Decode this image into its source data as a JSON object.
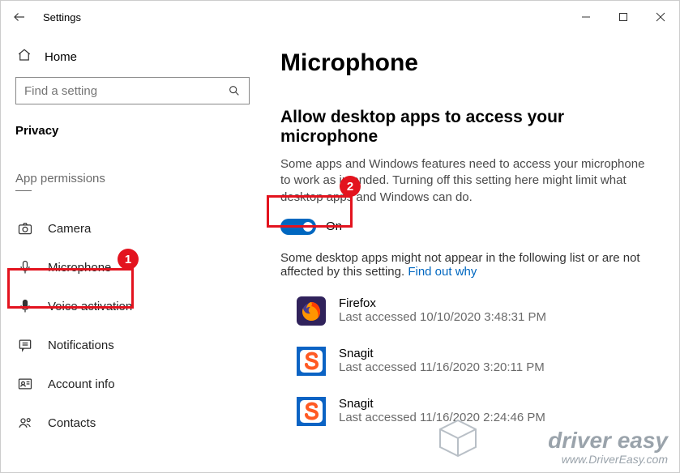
{
  "window": {
    "title": "Settings"
  },
  "sidebar": {
    "home": "Home",
    "search_placeholder": "Find a setting",
    "category": "Privacy",
    "section_label": "App permissions",
    "items": [
      {
        "label": "Camera"
      },
      {
        "label": "Microphone"
      },
      {
        "label": "Voice activation"
      },
      {
        "label": "Notifications"
      },
      {
        "label": "Account info"
      },
      {
        "label": "Contacts"
      }
    ]
  },
  "content": {
    "heading": "Microphone",
    "subheading": "Allow desktop apps to access your microphone",
    "description": "Some apps and Windows features need to access your microphone to work as intended. Turning off this setting here might limit what desktop apps and Windows can do.",
    "toggle_state": "On",
    "note_text": "Some desktop apps might not appear in the following list or are not affected by this setting. ",
    "note_link": "Find out why",
    "apps": [
      {
        "name": "Firefox",
        "sub": "Last accessed 10/10/2020 3:48:31 PM"
      },
      {
        "name": "Snagit",
        "sub": "Last accessed 11/16/2020 3:20:11 PM"
      },
      {
        "name": "Snagit",
        "sub": "Last accessed 11/16/2020 2:24:46 PM"
      }
    ]
  },
  "annotations": {
    "marker1": "1",
    "marker2": "2"
  },
  "watermark": {
    "line1": "driver easy",
    "line2": "www.DriverEasy.com"
  }
}
